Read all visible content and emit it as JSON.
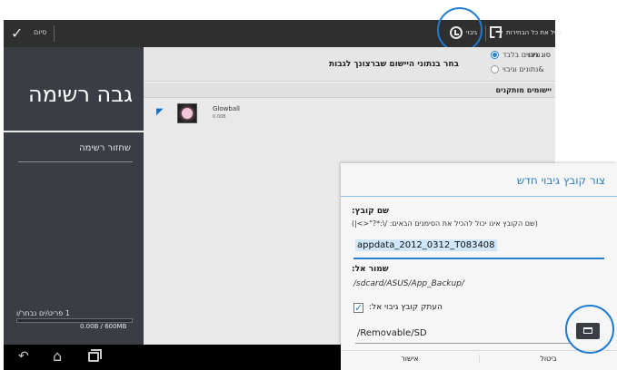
{
  "topbar": {
    "done_label": "סיום",
    "backup_label": "גיבוי",
    "select_all_label": "בטל את כל הבחירות",
    "done_icon": "check-icon",
    "backup_icon": "backup-icon",
    "select_all_icon": "select-all-icon"
  },
  "sidebar": {
    "title": "גבה רשימה",
    "clear_list": "שחזור רשימה",
    "selected_count": "1 פריט/ים נבחר/ו",
    "size_readout": "0.00B / 600MB",
    "storage_used_fraction": 0.0
  },
  "backup_type": {
    "label": "סוג גיבוי:",
    "options": [
      "נתונים בלבד",
      "&נתונים וגיבוי"
    ],
    "selected_index": 0,
    "instruction": "בחר בנתוני היישום שברצונך לגבות"
  },
  "installed": {
    "header": "יישומים מותקנים",
    "apps": [
      {
        "name": "Glowball",
        "size": "0.00B",
        "checked": true
      }
    ]
  },
  "dialog": {
    "title": "צור קובץ גיבוי חדש",
    "filename_label": "שם קובץ:",
    "filename_hint": "(שם הקובץ אינו יכול להכיל את הסימנים הבאים: /\\:*?\"<>|)",
    "filename_value": "appdata_2012_0312_T083408",
    "saveto_label": "שמור אל:",
    "saveto_path": "/sdcard/ASUS/App_Backup/",
    "copy_label": "העתק קובץ גיבוי אל:",
    "copy_checked": true,
    "removable_path": "/Removable/SD",
    "confirm_label": "אישור",
    "cancel_label": "ביטול"
  },
  "navbar": {
    "back_icon": "back-icon",
    "home_icon": "home-icon",
    "recent_icon": "recent-apps-icon"
  },
  "colors": {
    "topbar": "#2f2f2f",
    "sidebar": "#3a3d44",
    "accent": "#2a80d0",
    "highlight_ring": "#1f7ad1",
    "dialog_title": "#2f7fc4"
  }
}
